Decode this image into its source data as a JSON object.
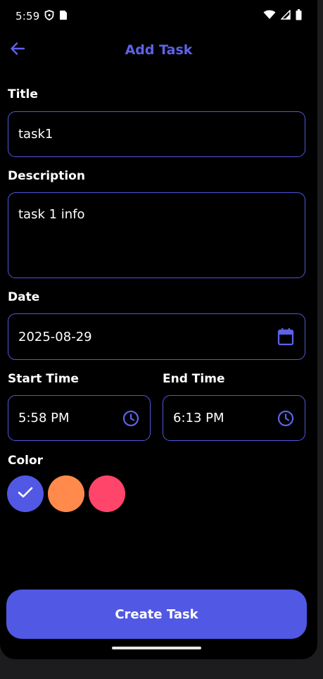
{
  "status_bar": {
    "time": "5:59"
  },
  "app_bar": {
    "title": "Add Task",
    "back_icon": "arrow-left-icon"
  },
  "form": {
    "title_label": "Title",
    "title_value": "task1",
    "description_label": "Description",
    "description_value": "task 1 info",
    "date_label": "Date",
    "date_value": "2025-08-29",
    "start_time_label": "Start Time",
    "start_time_value": "5:58 PM",
    "end_time_label": "End Time",
    "end_time_value": "6:13 PM",
    "color_label": "Color",
    "colors": [
      {
        "hex": "#5158e4",
        "selected": true
      },
      {
        "hex": "#ff8a4c",
        "selected": false
      },
      {
        "hex": "#ff4569",
        "selected": false
      }
    ]
  },
  "actions": {
    "create_label": "Create Task"
  },
  "theme": {
    "accent": "#5158e4",
    "background": "#000000"
  }
}
